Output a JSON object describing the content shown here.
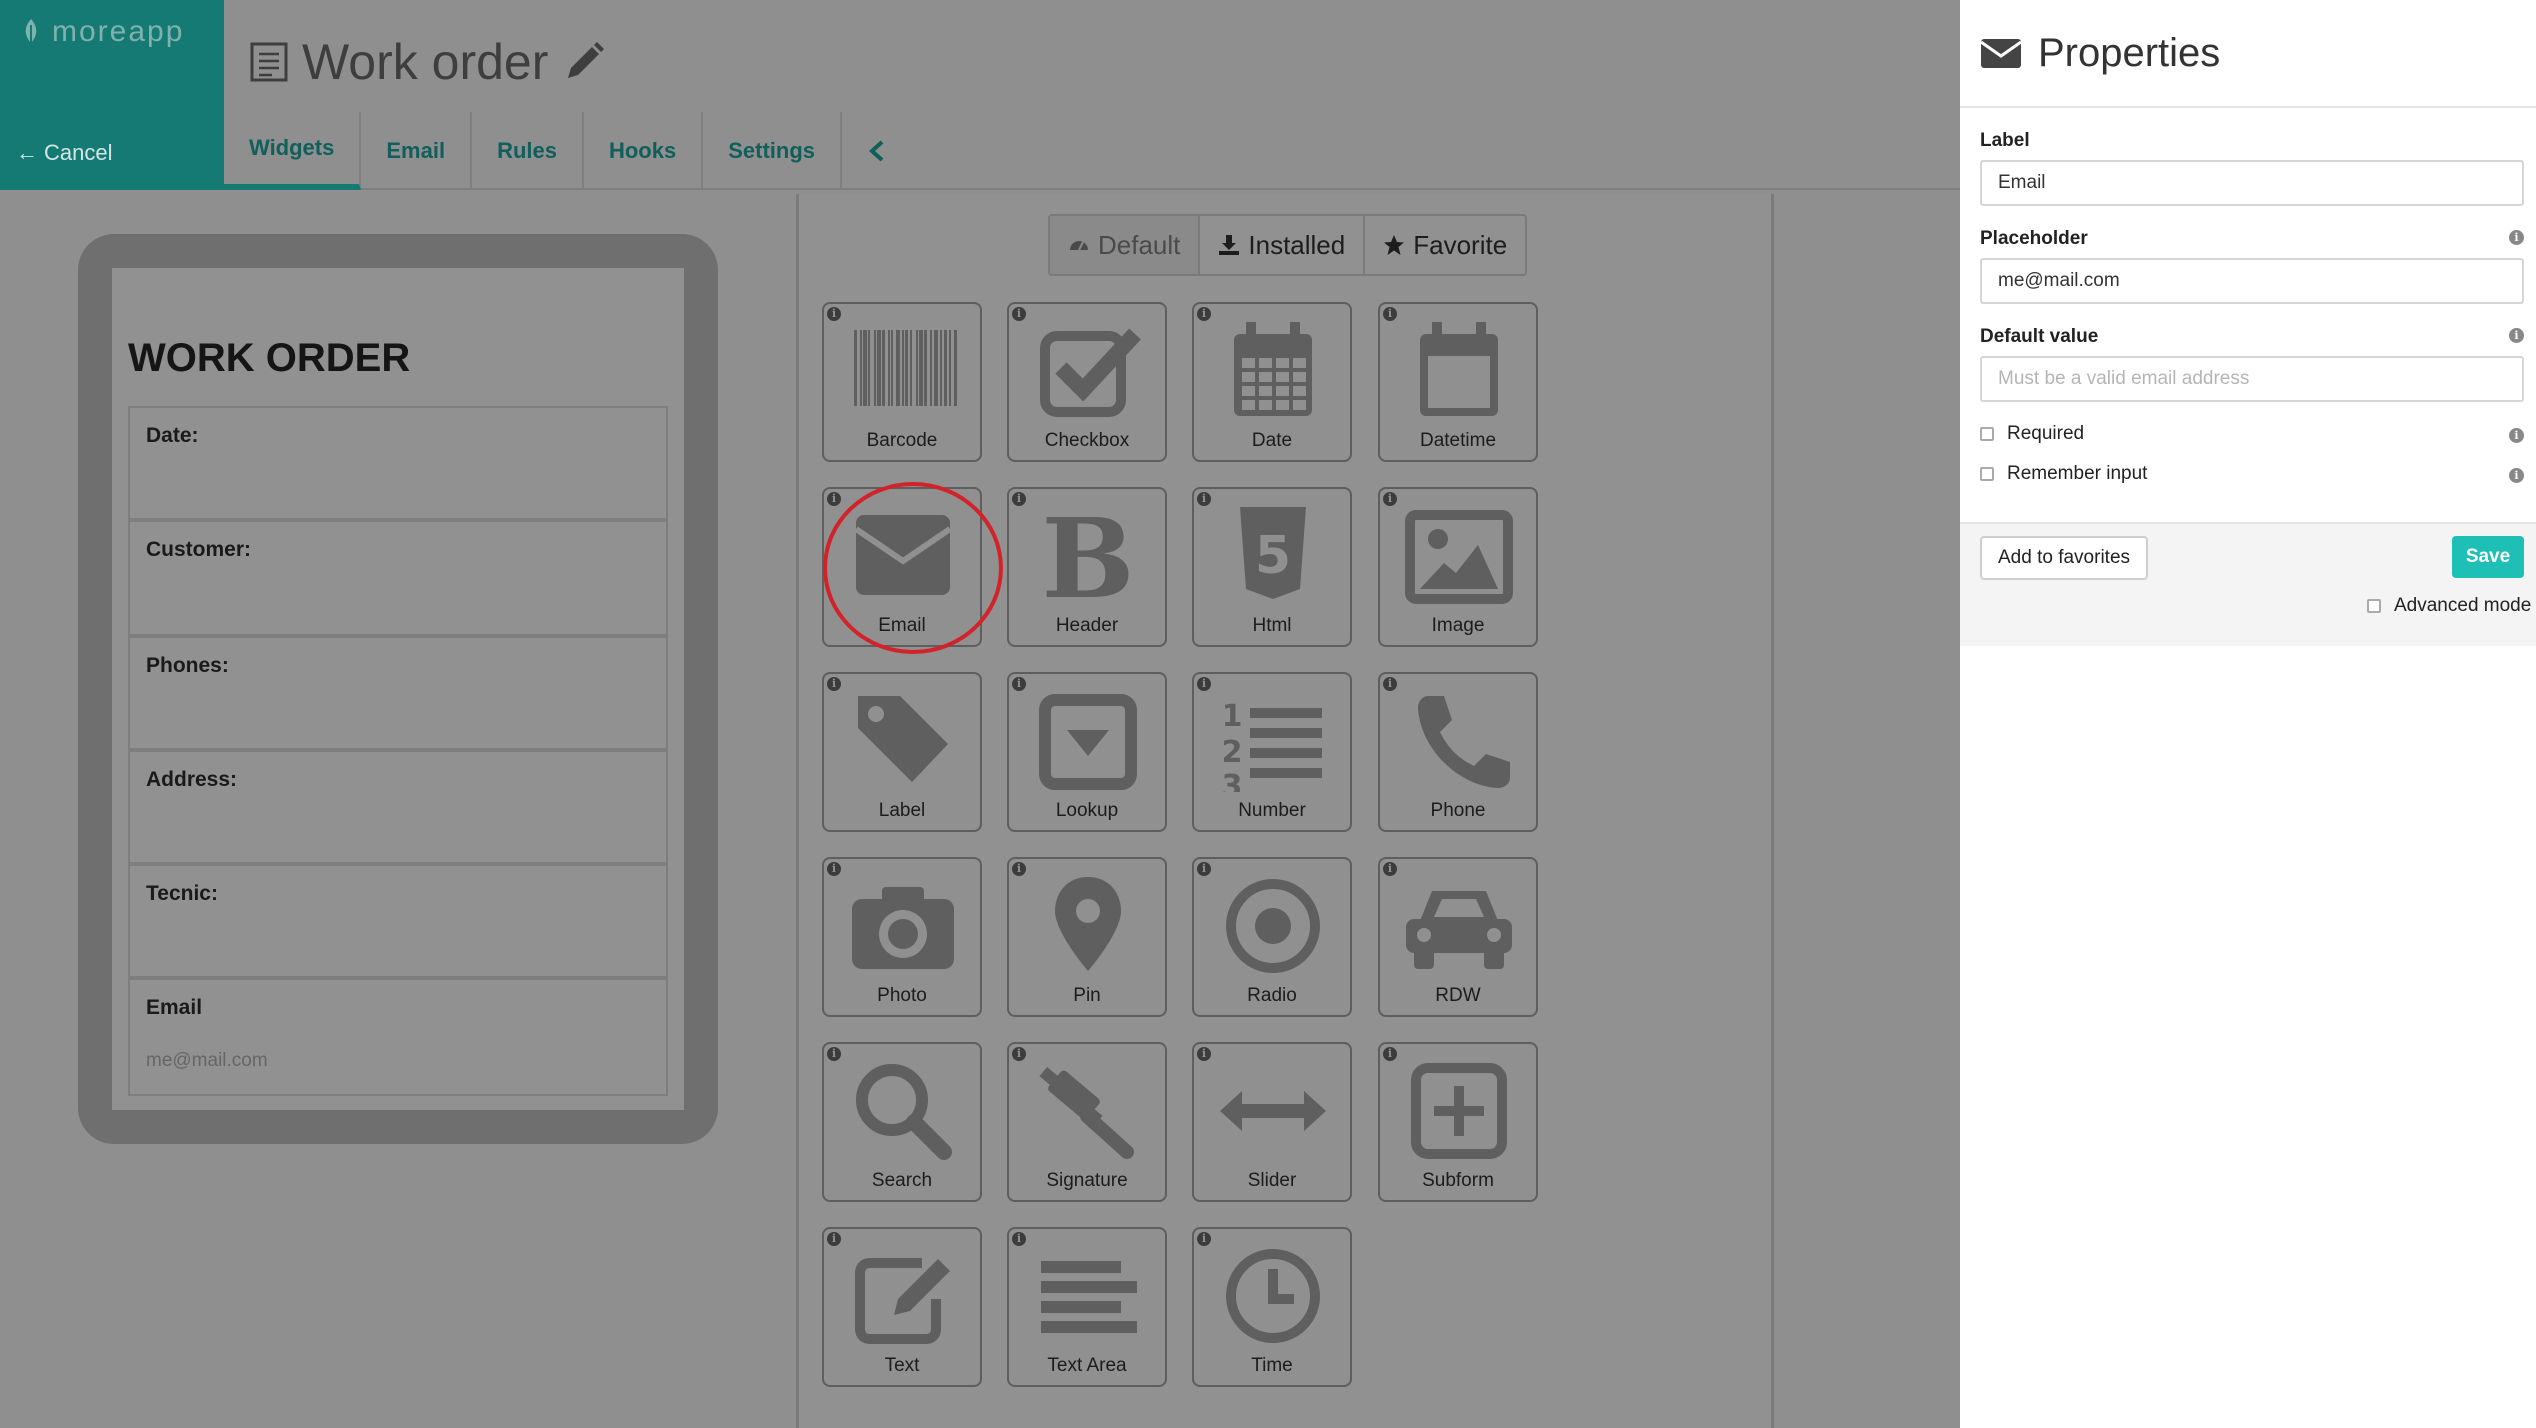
{
  "app": {
    "logo_text": "moreapp",
    "brand_color": "#167a74",
    "accent_color": "#1ebfb5"
  },
  "topbar": {
    "cancel_label": "Cancel",
    "form_title": "Work order",
    "tabs": [
      {
        "label": "Widgets",
        "active": true
      },
      {
        "label": "Email",
        "active": false
      },
      {
        "label": "Rules",
        "active": false
      },
      {
        "label": "Hooks",
        "active": false
      },
      {
        "label": "Settings",
        "active": false
      }
    ]
  },
  "preview": {
    "heading": "WORK ORDER",
    "fields": [
      {
        "label": "Date:"
      },
      {
        "label": "Customer:"
      },
      {
        "label": "Phones:"
      },
      {
        "label": "Address:"
      },
      {
        "label": "Tecnic:"
      },
      {
        "label": "Email",
        "placeholder": "me@mail.com"
      }
    ]
  },
  "widget_panel": {
    "filters": [
      {
        "label": "Default",
        "icon": "dashboard-icon",
        "active": false
      },
      {
        "label": "Installed",
        "icon": "download-icon",
        "active": true
      },
      {
        "label": "Favorite",
        "icon": "star-icon",
        "active": true
      }
    ],
    "info_glyph": "i",
    "selected_widget": "Email",
    "widgets": [
      {
        "label": "Barcode",
        "icon": "barcode-icon"
      },
      {
        "label": "Checkbox",
        "icon": "checkbox-icon"
      },
      {
        "label": "Date",
        "icon": "calendar-icon"
      },
      {
        "label": "Datetime",
        "icon": "calendar-empty-icon"
      },
      {
        "label": "Email",
        "icon": "envelope-icon"
      },
      {
        "label": "Header",
        "icon": "bold-b-icon"
      },
      {
        "label": "Html",
        "icon": "html5-icon"
      },
      {
        "label": "Image",
        "icon": "image-icon"
      },
      {
        "label": "Label",
        "icon": "tag-icon"
      },
      {
        "label": "Lookup",
        "icon": "dropdown-icon"
      },
      {
        "label": "Number",
        "icon": "numbered-list-icon"
      },
      {
        "label": "Phone",
        "icon": "phone-icon"
      },
      {
        "label": "Photo",
        "icon": "camera-icon"
      },
      {
        "label": "Pin",
        "icon": "map-pin-icon"
      },
      {
        "label": "Radio",
        "icon": "radio-icon"
      },
      {
        "label": "RDW",
        "icon": "car-icon"
      },
      {
        "label": "Search",
        "icon": "magnifier-icon"
      },
      {
        "label": "Signature",
        "icon": "gavel-icon"
      },
      {
        "label": "Slider",
        "icon": "arrows-horizontal-icon"
      },
      {
        "label": "Subform",
        "icon": "plus-square-icon"
      },
      {
        "label": "Text",
        "icon": "edit-icon"
      },
      {
        "label": "Text Area",
        "icon": "align-lines-icon"
      },
      {
        "label": "Time",
        "icon": "clock-icon"
      }
    ]
  },
  "properties": {
    "title": "Properties",
    "label_field": {
      "label": "Label",
      "value": "Email"
    },
    "placeholder_field": {
      "label": "Placeholder",
      "value": "me@mail.com"
    },
    "default_field": {
      "label": "Default value",
      "placeholder": "Must be a valid email address",
      "value": ""
    },
    "required": {
      "label": "Required",
      "checked": false
    },
    "remember": {
      "label": "Remember input",
      "checked": false
    },
    "add_favorites_label": "Add to favorites",
    "save_label": "Save",
    "advanced_label": "Advanced mode",
    "advanced_checked": false
  }
}
